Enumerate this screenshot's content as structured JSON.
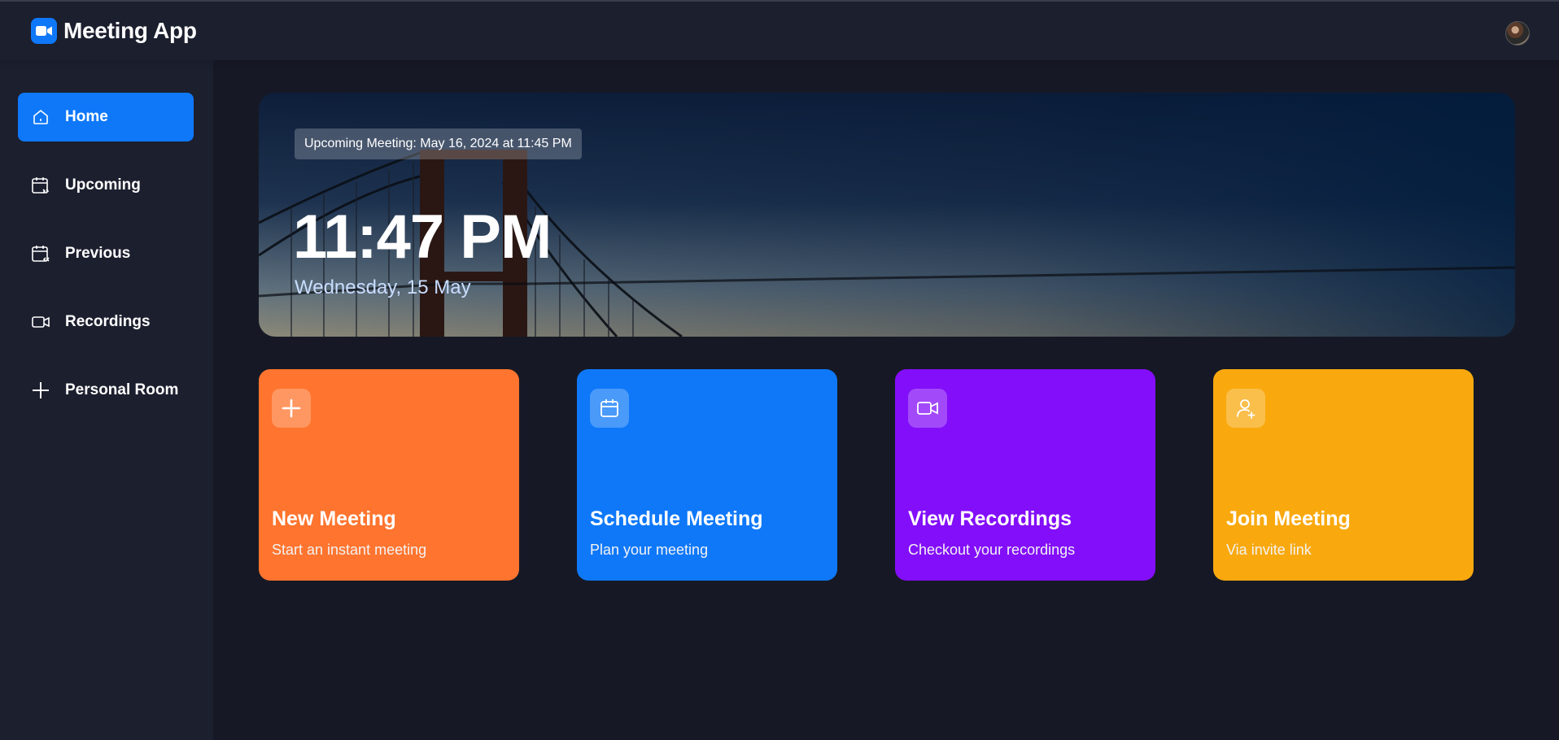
{
  "app": {
    "title": "Meeting App"
  },
  "colors": {
    "accent": "#0e78f9",
    "orange": "#ff742e",
    "blue": "#0e78f9",
    "purple": "#830ef9",
    "yellow": "#f9a90e",
    "background": "#1c1f2e"
  },
  "sidebar": {
    "items": [
      {
        "label": "Home",
        "icon": "home-icon",
        "active": true
      },
      {
        "label": "Upcoming",
        "icon": "calendar-forward-icon"
      },
      {
        "label": "Previous",
        "icon": "calendar-back-icon"
      },
      {
        "label": "Recordings",
        "icon": "video-icon"
      },
      {
        "label": "Personal Room",
        "icon": "plus-icon"
      }
    ]
  },
  "hero": {
    "upcoming": "Upcoming Meeting: May 16, 2024 at 11:45 PM",
    "time": "11:47 PM",
    "date": "Wednesday, 15 May"
  },
  "cards": [
    {
      "title": "New Meeting",
      "subtitle": "Start an instant meeting",
      "icon": "plus-icon"
    },
    {
      "title": "Schedule Meeting",
      "subtitle": "Plan your meeting",
      "icon": "calendar-icon"
    },
    {
      "title": "View Recordings",
      "subtitle": "Checkout your recordings",
      "icon": "video-icon"
    },
    {
      "title": "Join Meeting",
      "subtitle": "Via invite link",
      "icon": "user-plus-icon"
    }
  ]
}
